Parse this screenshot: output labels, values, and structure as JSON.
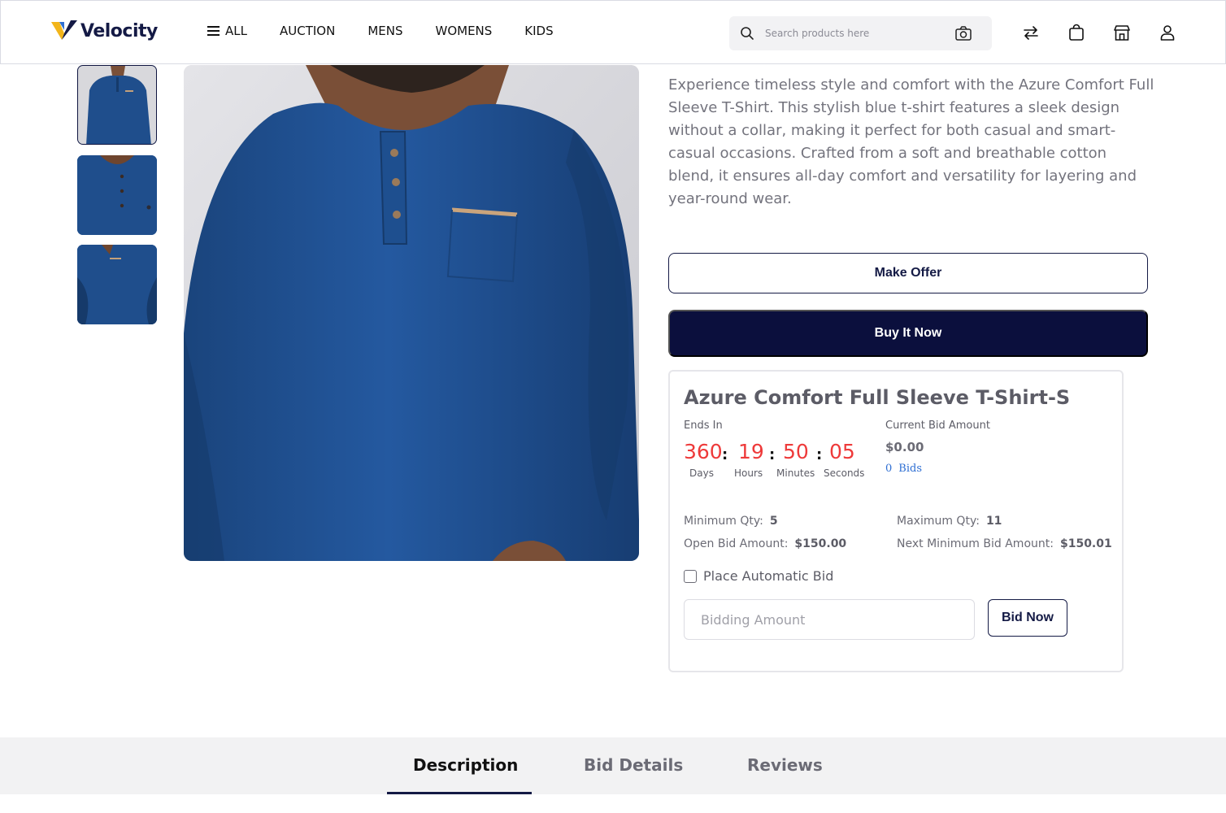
{
  "header": {
    "logo_text": "Velocity",
    "nav": [
      {
        "label": "ALL",
        "icon": "hamburger-menu-icon"
      },
      {
        "label": "AUCTION"
      },
      {
        "label": "MENS"
      },
      {
        "label": "WOMENS"
      },
      {
        "label": "KIDS"
      }
    ],
    "search_placeholder": "Search products here",
    "icons": [
      "compare-arrows-icon",
      "shopping-bag-icon",
      "store-icon",
      "user-icon"
    ]
  },
  "gallery": {
    "thumbnails": [
      "front-view",
      "chest-closeup",
      "side-view"
    ],
    "active_index": 0
  },
  "product": {
    "description": "Experience timeless style and comfort with the Azure Comfort Full Sleeve T-Shirt. This stylish blue t-shirt features a sleek design without a collar, making it perfect for both casual and smart-casual occasions. Crafted from a soft and breathable cotton blend, it ensures all-day comfort and versatility for layering and year-round wear.",
    "make_offer_label": "Make Offer",
    "buy_now_label": "Buy It Now"
  },
  "bid": {
    "title": "Azure Comfort Full Sleeve T-Shirt-S",
    "ends_in_label": "Ends In",
    "countdown": {
      "days": "360",
      "hours": "19",
      "minutes": "50",
      "seconds": "05",
      "days_label": "Days",
      "hours_label": "Hours",
      "minutes_label": "Minutes",
      "seconds_label": "Seconds",
      "separator": ":"
    },
    "current_bid_label": "Current Bid Amount",
    "current_bid_value": "$0.00",
    "bid_count": "0",
    "bids_label": "Bids",
    "min_qty_label": "Minimum Qty:",
    "min_qty_value": "5",
    "max_qty_label": "Maximum Qty:",
    "max_qty_value": "11",
    "open_bid_label": "Open Bid Amount:",
    "open_bid_value": "$150.00",
    "next_min_label": "Next Minimum Bid Amount:",
    "next_min_value": "$150.01",
    "auto_bid_label": "Place Automatic Bid",
    "auto_bid_checked": false,
    "input_placeholder": "Bidding Amount",
    "bid_now_label": "Bid Now"
  },
  "tabs": [
    {
      "label": "Description",
      "active": true
    },
    {
      "label": "Bid Details",
      "active": false
    },
    {
      "label": "Reviews",
      "active": false
    }
  ],
  "colors": {
    "brand_navy": "#0b0f3d",
    "countdown_red": "#ee3a3a",
    "link_blue": "#2f6fd3",
    "logo_yellow": "#f2b51a",
    "shirt_blue": "#1f4e8c"
  }
}
